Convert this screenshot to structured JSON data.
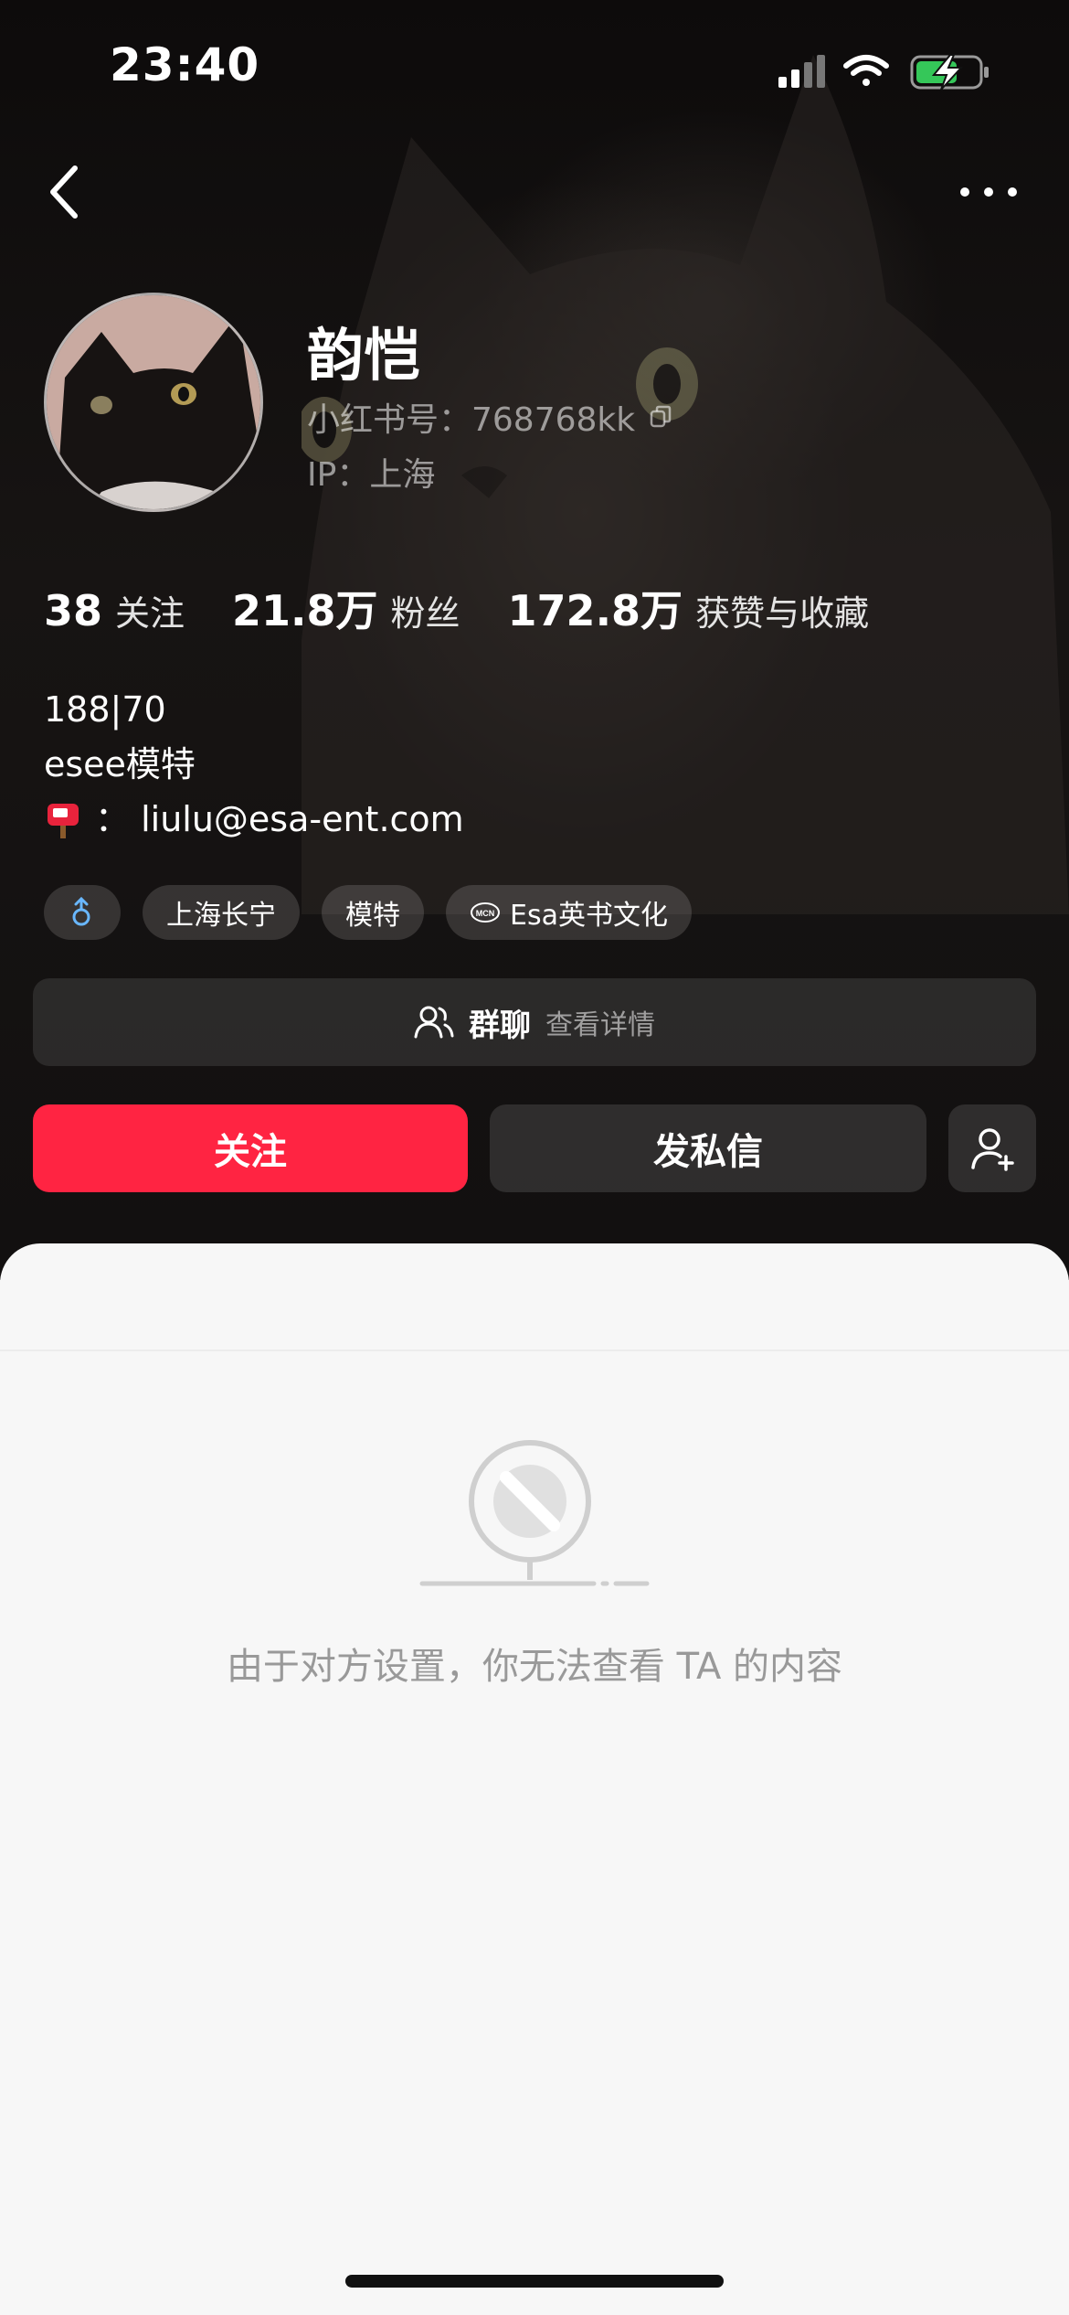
{
  "status_bar": {
    "time": "23:40",
    "icons": [
      "cellular-signal-icon",
      "wifi-icon",
      "battery-charging-icon"
    ]
  },
  "nav": {
    "back_icon": "chevron-left-icon",
    "more_icon": "ellipsis-icon"
  },
  "profile": {
    "display_name": "韵恺",
    "user_id": "小红书号：768768kk",
    "ip_location": "IP：上海",
    "avatar_icon": "avatar-cat-photo"
  },
  "stats": [
    {
      "value": "38",
      "label": "关注"
    },
    {
      "value": "21.8万",
      "label": "粉丝"
    },
    {
      "value": "172.8万",
      "label": "获赞与收藏"
    }
  ],
  "bio": {
    "line1": "188|70",
    "line2": "esee模特",
    "line3_icon": "mailbox-emoji",
    "line3": "： liulu@esa-ent.com"
  },
  "tags": [
    {
      "icon": "male-gender-icon",
      "label": ""
    },
    {
      "label": "上海长宁"
    },
    {
      "label": "模特"
    },
    {
      "icon": "mcn-icon",
      "label": "Esa英书文化"
    }
  ],
  "group_chat": {
    "icon": "group-users-icon",
    "title": "群聊",
    "subtitle": "查看详情"
  },
  "actions": {
    "follow_label": "关注",
    "message_label": "发私信",
    "add_friend_icon": "add-user-icon"
  },
  "empty_state": {
    "icon": "restricted-content-icon",
    "message": "由于对方设置，你无法查看 TA 的内容"
  },
  "colors": {
    "accent": "#ff2442",
    "hero_background": "#141111",
    "sheet_background": "#f7f7f7",
    "muted_text": "#999999"
  }
}
